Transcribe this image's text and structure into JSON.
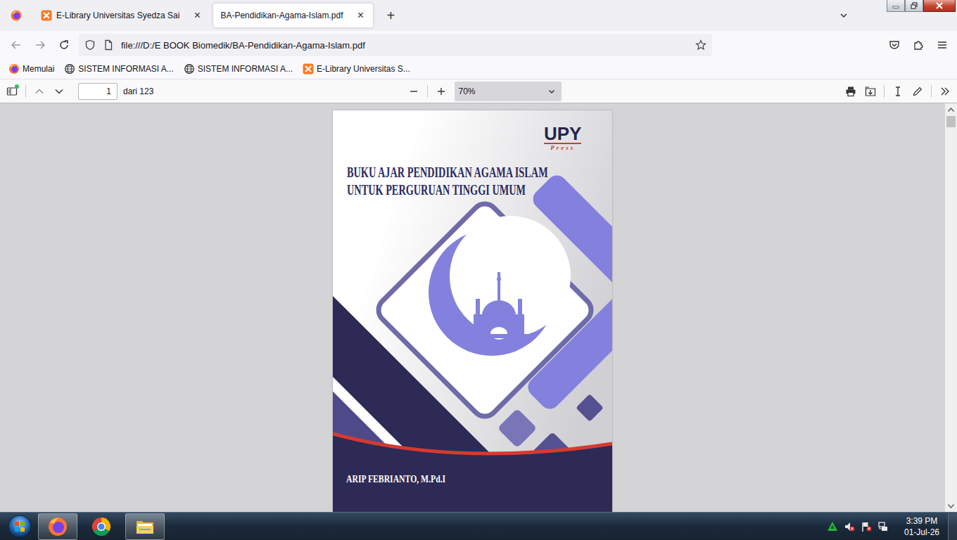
{
  "tabs": [
    {
      "label": "E-Library Universitas Syedza Sai",
      "selected": false,
      "close": "×",
      "icon": "xampp"
    },
    {
      "label": "BA-Pendidikan-Agama-Islam.pdf",
      "selected": true,
      "close": "×",
      "icon": "none"
    }
  ],
  "new_tab": "+",
  "address": "file:///D:/E BOOK Biomedik/BA-Pendidikan-Agama-Islam.pdf",
  "bookmarks": [
    {
      "label": "Memulai",
      "kind": "firefox"
    },
    {
      "label": "SISTEM INFORMASI A...",
      "kind": "globe"
    },
    {
      "label": "SISTEM INFORMASI A...",
      "kind": "globe"
    },
    {
      "label": "E-Library Universitas S...",
      "kind": "xampp"
    }
  ],
  "pdf_toolbar": {
    "sidebar_dot": true,
    "page": "1",
    "page_count": "dari 123",
    "zoom": "70%"
  },
  "document": {
    "publisher": "UPY",
    "publisher_sub": "Press",
    "title_lines": [
      "BUKU AJAR PENDIDIKAN AGAMA ISLAM",
      "UNTUK PERGURUAN TINGGI UMUM"
    ],
    "author": "ARIP FEBRIANTO, M.Pd.I"
  },
  "taskbar": {
    "apps": [
      {
        "kind": "firefox",
        "running": true
      },
      {
        "kind": "chrome",
        "running": false
      },
      {
        "kind": "explorer",
        "running": true
      }
    ],
    "time": "3:39 PM",
    "date": "01-Jul-26"
  }
}
